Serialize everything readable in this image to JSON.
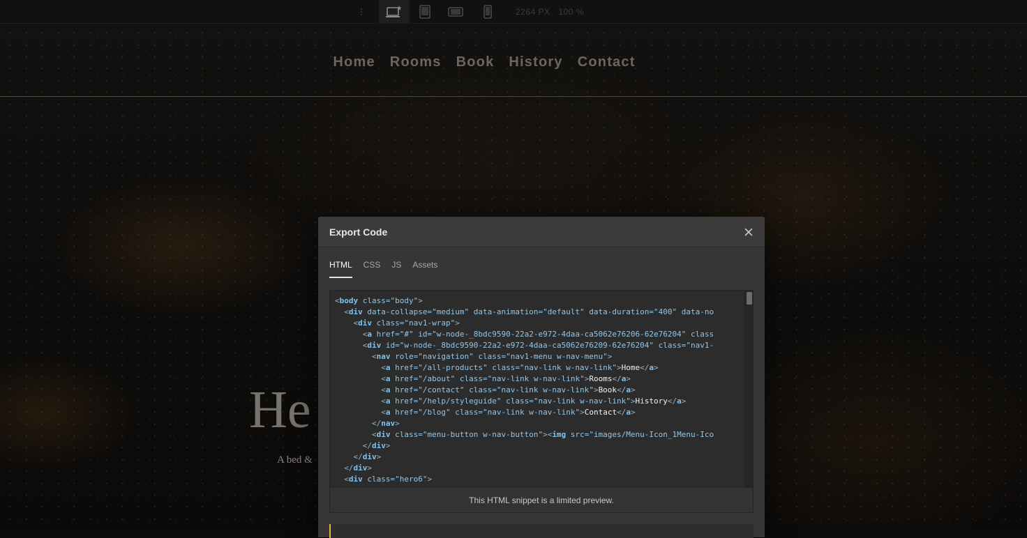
{
  "toolbar": {
    "readout_width": "2264 PX",
    "readout_zoom": "100 %",
    "devices": [
      {
        "name": "desktop-star",
        "active": true
      },
      {
        "name": "tablet",
        "active": false
      },
      {
        "name": "mobile-landscape",
        "active": false
      },
      {
        "name": "mobile-portrait",
        "active": false
      }
    ]
  },
  "site": {
    "nav": [
      "Home",
      "Rooms",
      "Book",
      "History",
      "Contact"
    ],
    "hero_heading": "He",
    "hero_sub": "A bed &"
  },
  "modal": {
    "title": "Export Code",
    "tabs": [
      "HTML",
      "CSS",
      "JS",
      "Assets"
    ],
    "active_tab": "HTML",
    "footer_note": "This HTML snippet is a limited preview.",
    "code_lines": [
      "<body class=\"body\">",
      "  <div data-collapse=\"medium\" data-animation=\"default\" data-duration=\"400\" data-no",
      "    <div class=\"nav1-wrap\">",
      "      <a href=\"#\" id=\"w-node-_8bdc9590-22a2-e972-4daa-ca5062e76206-62e76204\" class",
      "      <div id=\"w-node-_8bdc9590-22a2-e972-4daa-ca5062e76209-62e76204\" class=\"nav1-",
      "        <nav role=\"navigation\" class=\"nav1-menu w-nav-menu\">",
      "          <a href=\"/all-products\" class=\"nav-link w-nav-link\">Home</a>",
      "          <a href=\"/about\" class=\"nav-link w-nav-link\">Rooms</a>",
      "          <a href=\"/contact\" class=\"nav-link w-nav-link\">Book</a>",
      "          <a href=\"/help/styleguide\" class=\"nav-link w-nav-link\">History</a>",
      "          <a href=\"/blog\" class=\"nav-link w-nav-link\">Contact</a>",
      "        </nav>",
      "        <div class=\"menu-button w-nav-button\"><img src=\"images/Menu-Icon_1Menu-Ico",
      "      </div>",
      "    </div>",
      "  </div>",
      "  <div class=\"hero6\">"
    ]
  },
  "colors": {
    "modal_bg": "#363636",
    "tag": "#7ec3f2",
    "attr": "#93c5e8",
    "value": "#b4e07f",
    "accent_strip": "#e0b53a"
  }
}
